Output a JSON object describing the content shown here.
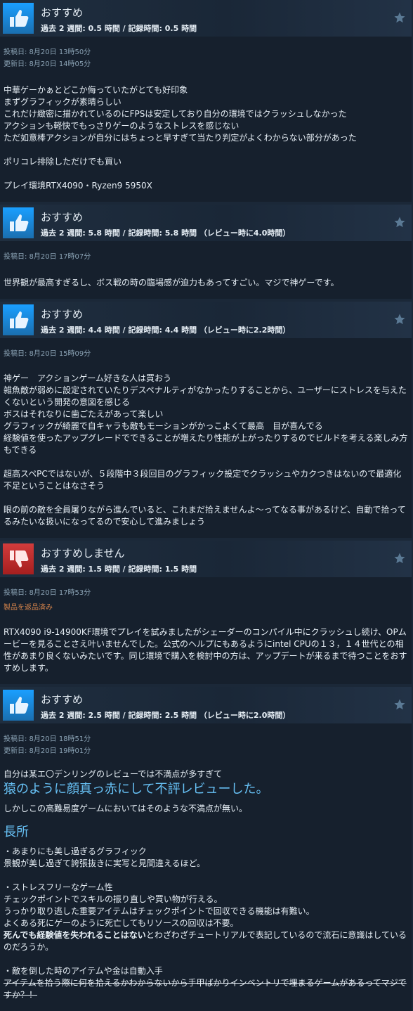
{
  "reviews": [
    {
      "verdict": "おすすめ",
      "hours": "過去 2 週間: 0.5 時間 / 記録時間: 0.5 時間",
      "posted": "投稿日: 8月20日 13時50分",
      "updated": "更新日: 8月20日 14時05分",
      "lines": [
        "中華ゲーかぁとどこか侮っていたがとても好印象",
        "まずグラフィックが素晴らしい",
        "これだけ緻密に描かれているのにFPSは安定しており自分の環境ではクラッシュしなかった",
        "アクションも軽快でもっさりゲーのようなストレスを感じない",
        "ただ如意棒アクションが自分にはちょっと早すぎて当たり判定がよくわからない部分があった",
        "",
        "ポリコレ排除しただけでも買い",
        "",
        "プレイ環境RTX4090・Ryzen9 5950X"
      ]
    },
    {
      "verdict": "おすすめ",
      "hours": "過去 2 週間: 5.8 時間 / 記録時間: 5.8 時間 （レビュー時に4.0時間）",
      "posted": "投稿日: 8月20日 17時07分",
      "lines": [
        "世界観が最高すぎるし、ボス戦の時の臨場感が迫力もあってすごい。マジで神ゲーです。"
      ]
    },
    {
      "verdict": "おすすめ",
      "hours": "過去 2 週間: 4.4 時間 / 記録時間: 4.4 時間 （レビュー時に2.2時間）",
      "posted": "投稿日: 8月20日 15時09分",
      "lines": [
        "神ゲー　アクションゲーム好きな人は買おう",
        "雑魚敵が弱めに設定されていたりデスペナルティがなかったりすることから、ユーザーにストレスを与えたくないという開発の意図を感じる",
        "ボスはそれなりに歯ごたえがあって楽しい",
        "グラフィックが綺麗で自キャラも敵もモーションがかっこよくて最高　目が喜んでる",
        "経験値を使ったアップグレードでできることが増えたり性能が上がったりするのでビルドを考える楽しみ方もできる",
        "",
        "超高スペPCではないが、５段階中３段回目のグラフィック設定でクラッシュやカクつきはないので最適化不足ということはなさそう",
        "",
        "眼の前の敵を全員屠りながら進んでいると、これまだ拾えませんよ～ってなる事があるけど、自動で拾ってるみたいな扱いになってるので安心して進みましょう"
      ]
    },
    {
      "verdict": "おすすめしません",
      "hours": "過去 2 週間: 1.5 時間 / 記録時間: 1.5 時間",
      "posted": "投稿日: 8月20日 17時53分",
      "refund": "製品を返品済み",
      "lines": [
        "RTX4090 i9-14900KF環境でプレイを試みましたがシェーダーのコンパイル中にクラッシュし続け、OPムービーを見ることさえ叶いませんでした。公式のヘルプにもあるようにintel CPUの１３，１４世代との相性があまり良くないみたいです。同じ環境で購入を検討中の方は、アップデートが来るまで待つことをおすすめします。"
      ]
    },
    {
      "verdict": "おすすめ",
      "hours": "過去 2 週間: 2.5 時間 / 記録時間: 2.5 時間 （レビュー時に2.0時間）",
      "posted": "投稿日: 8月20日 18時51分",
      "updated": "更新日: 8月20日 19時01分",
      "intro": "自分は某エ〇デンリングのレビューでは不満点が多すぎて",
      "big_line": "猿のように顔真っ赤にして不評レビューした。",
      "after_big": "しかしこの高難易度ゲームにおいてはそのような不満点が無い。",
      "section_title": "長所",
      "pros": [
        "・あまりにも美し過ぎるグラフィック",
        "景観が美し過ぎて誇張抜きに実写と見間違えるほど。",
        "",
        "・ストレスフリーなゲーム性",
        "チェックポイントでスキルの振り直しや買い物が行える。",
        "うっかり取り逃した重要アイテムはチェックポイントで回収できる機能は有難い。",
        "よくある死にゲーのように死亡してもリソースの回収は不要。"
      ],
      "strong_part": "死んでも経験値を失われることはない",
      "after_strong": "とわざわざチュートリアルで表記しているので流石に意識はしているのだろうか。",
      "drop_title": "・敵を倒した時のアイテムや金は自動入手",
      "strike_text": "アイテムを拾う際に何を拾えるかわからないから手甲ばかりインベントリで埋まるゲームがあるってマジですか？！"
    }
  ]
}
